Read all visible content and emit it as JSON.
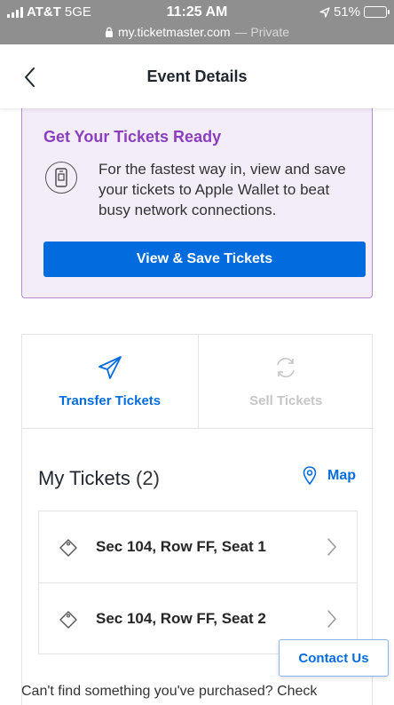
{
  "status_bar": {
    "carrier": "AT&T",
    "network": "5GE",
    "time": "11:25 AM",
    "battery": "51%",
    "battery_level": 0.51,
    "url": "my.ticketmaster.com",
    "private_label": "— Private"
  },
  "header": {
    "title": "Event Details"
  },
  "ready_card": {
    "title": "Get Your Tickets Ready",
    "text": "For the fastest way in, view and save your tickets to Apple Wallet to beat busy network connections.",
    "button_label": "View & Save Tickets"
  },
  "actions": {
    "transfer_label": "Transfer Tickets",
    "sell_label": "Sell Tickets"
  },
  "my_tickets": {
    "title": "My Tickets",
    "count": "(2)",
    "map_label": "Map",
    "items": [
      {
        "label": "Sec 104, Row FF, Seat 1"
      },
      {
        "label": "Sec 104, Row FF, Seat 2"
      }
    ]
  },
  "contact_label": "Contact Us",
  "footer_text": "Can't find something you've purchased? Check",
  "colors": {
    "accent": "#026cdf",
    "purple": "#8b3fbd",
    "card_bg": "#f3ecf9",
    "status_bar": "#8f8f8f"
  },
  "icons": {
    "back": "chevron-left-icon",
    "wallet": "phone-wallet-icon",
    "transfer": "paper-plane-icon",
    "sell": "refresh-icon",
    "map": "map-pin-icon",
    "ticket": "ticket-tag-icon",
    "row": "chevron-right-icon"
  }
}
